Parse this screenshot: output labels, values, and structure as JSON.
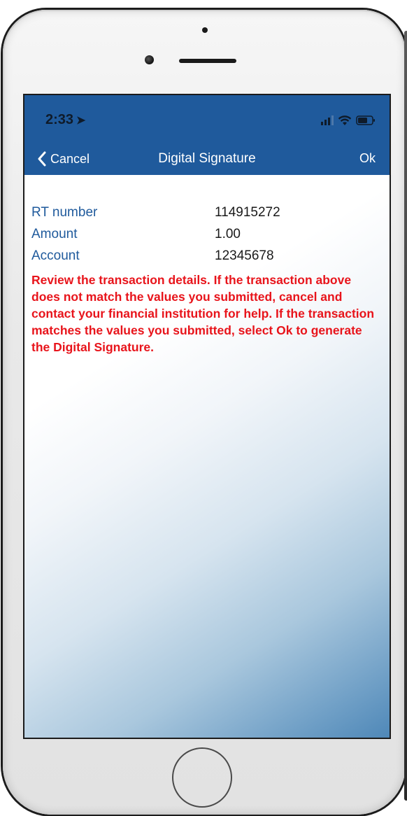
{
  "status_bar": {
    "time": "2:33"
  },
  "nav": {
    "cancel_label": "Cancel",
    "title": "Digital Signature",
    "ok_label": "Ok"
  },
  "details": [
    {
      "label": "RT number",
      "value": "114915272"
    },
    {
      "label": "Amount",
      "value": "1.00"
    },
    {
      "label": "Account",
      "value": "12345678"
    }
  ],
  "warning": "Review the transaction details. If the transaction above does not match the values you submitted, cancel and contact your financial institution for help. If the transaction matches the values you submitted, select Ok to generate the Digital Signature.",
  "colors": {
    "header": "#1f5a9c",
    "label": "#1f5a9c",
    "warning": "#e8141b"
  },
  "icons": [
    "location-arrow-icon",
    "signal-icon",
    "wifi-icon",
    "battery-icon",
    "chevron-left-icon"
  ]
}
